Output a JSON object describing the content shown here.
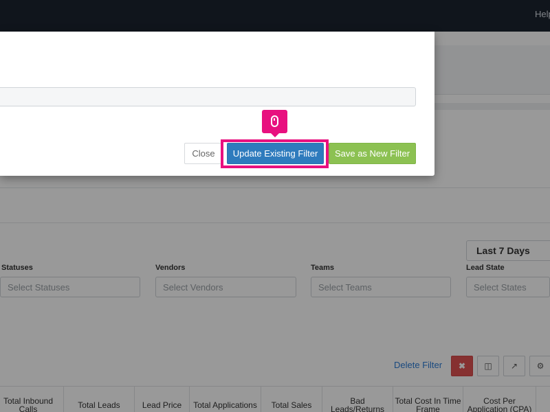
{
  "topbar": {
    "help_label": "Help"
  },
  "filters": {
    "date_range": "Last 7 Days",
    "statuses": {
      "label": "Statuses",
      "placeholder": "Select Statuses"
    },
    "vendors": {
      "label": "Vendors",
      "placeholder": "Select Vendors"
    },
    "teams": {
      "label": "Teams",
      "placeholder": "Select Teams"
    },
    "lead_state": {
      "label": "Lead State",
      "placeholder": "Select States"
    }
  },
  "toolbar": {
    "delete_filter": "Delete Filter",
    "icons": [
      "close-icon",
      "save-icon",
      "external-link-icon",
      "gear-icon"
    ],
    "delete_color": "#e05252"
  },
  "table": {
    "headers": [
      "Total Inbound Calls",
      "Total Leads",
      "Lead Price",
      "Total Applications",
      "Total Sales",
      "Bad Leads/Returns",
      "Total Cost In Time Frame",
      "Cost Per Application (CPA)"
    ]
  },
  "modal": {
    "filter_name_value": "",
    "close_label": "Close",
    "update_label": "Update Existing Filter",
    "save_new_label": "Save as New Filter"
  },
  "colors": {
    "topbar": "#1b2430",
    "primary": "#2e7bbd",
    "success": "#8cc152",
    "highlight": "#e8107f"
  }
}
